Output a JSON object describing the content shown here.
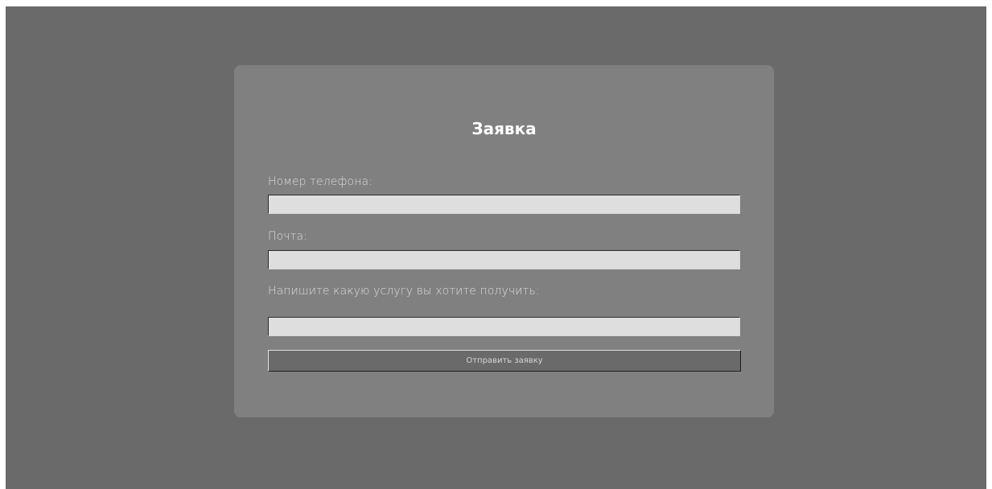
{
  "form": {
    "title": "Заявка",
    "phone": {
      "label": "Номер телефона:",
      "value": "",
      "placeholder": ""
    },
    "email": {
      "label": "Почта:",
      "value": "",
      "placeholder": ""
    },
    "service": {
      "label": "Напишите какую услугу вы хотите получить:",
      "value": "",
      "placeholder": ""
    },
    "submit_label": "Отправить заявку"
  },
  "colors": {
    "page_background": "#6a6a6a",
    "card_background": "#808080",
    "input_background": "#dedede",
    "button_background": "#6a6a6a",
    "title_color": "#ffffff",
    "label_color": "#dcdcdc"
  }
}
